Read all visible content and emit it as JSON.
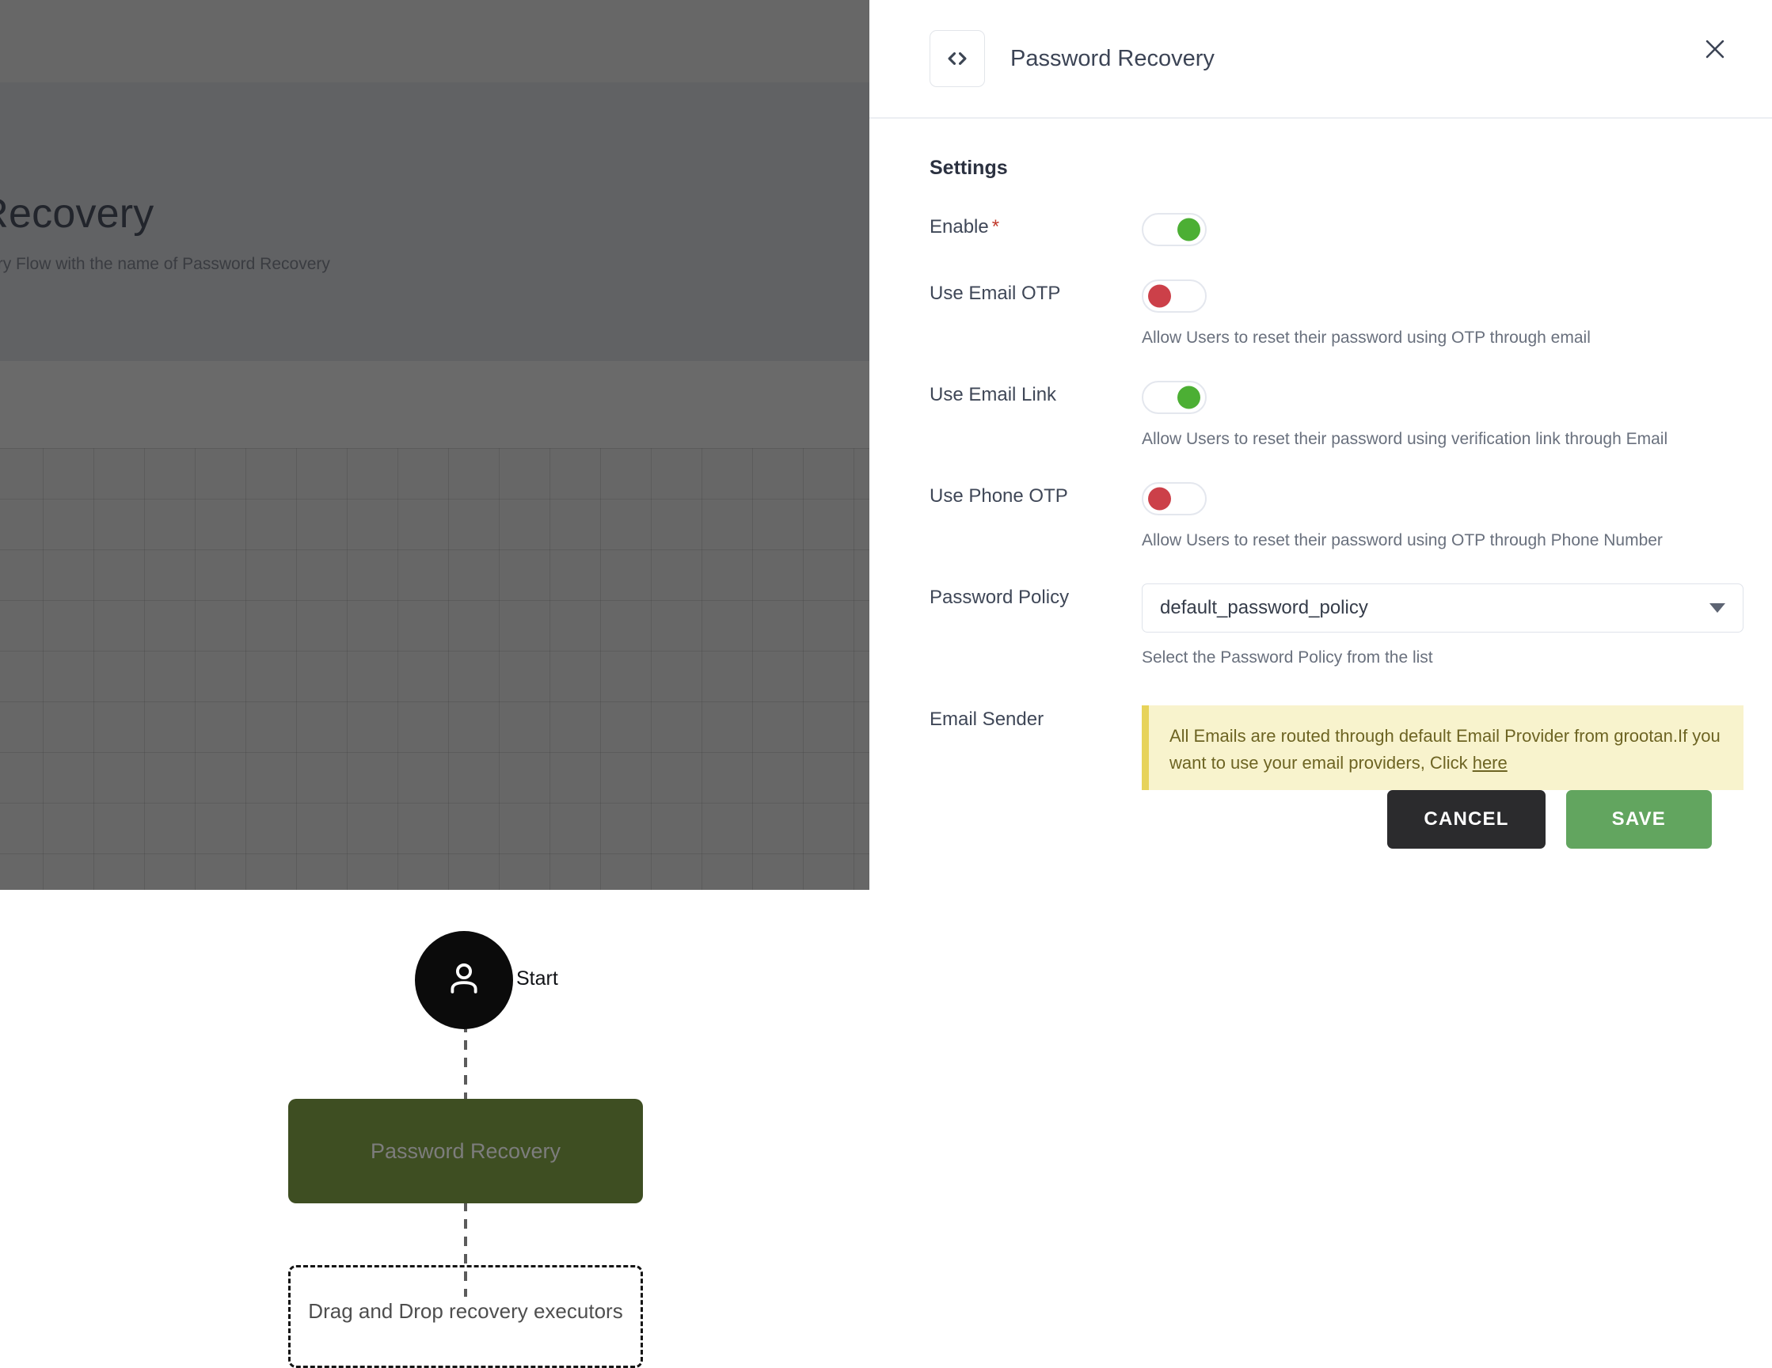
{
  "background": {
    "page_title": "rd Recovery",
    "page_subtitle": "nrecovery Flow with the name of Password Recovery",
    "flow": {
      "start_label": "Start",
      "start_icon": "user-icon",
      "node_label": "Password Recovery",
      "dropzone_label": "Drag and Drop recovery executors"
    }
  },
  "drawer": {
    "icon": "code-icon",
    "title": "Password Recovery",
    "close_icon": "close-icon",
    "section_title": "Settings",
    "fields": {
      "enable": {
        "label": "Enable",
        "required_marker": "*",
        "state": "on",
        "helper": ""
      },
      "email_otp": {
        "label": "Use Email OTP",
        "state": "off",
        "helper": "Allow Users to reset their password using OTP through email"
      },
      "email_link": {
        "label": "Use Email Link",
        "state": "on",
        "helper": "Allow Users to reset their password using verification link through Email"
      },
      "phone_otp": {
        "label": "Use Phone OTP",
        "state": "off",
        "helper": "Allow Users to reset their password using OTP through Phone Number"
      },
      "password_policy": {
        "label": "Password Policy",
        "value": "default_password_policy",
        "helper": "Select the Password Policy from the list",
        "arrow_icon": "chevron-down-icon"
      },
      "email_sender": {
        "label": "Email Sender",
        "alert_text": "All Emails are routed through default Email Provider from grootan.If you want to use your email providers, Click ",
        "alert_link": "here"
      }
    },
    "footer": {
      "cancel_label": "CANCEL",
      "save_label": "SAVE"
    }
  },
  "colors": {
    "toggle_on": "#4caf34",
    "toggle_off": "#cc4049",
    "save_button": "#62a55f",
    "cancel_button": "#2b2b2d",
    "alert_bg": "#f8f3cd",
    "alert_border": "#e7d35a",
    "node_green": "#3e4e22",
    "required_marker": "#c0392b"
  }
}
